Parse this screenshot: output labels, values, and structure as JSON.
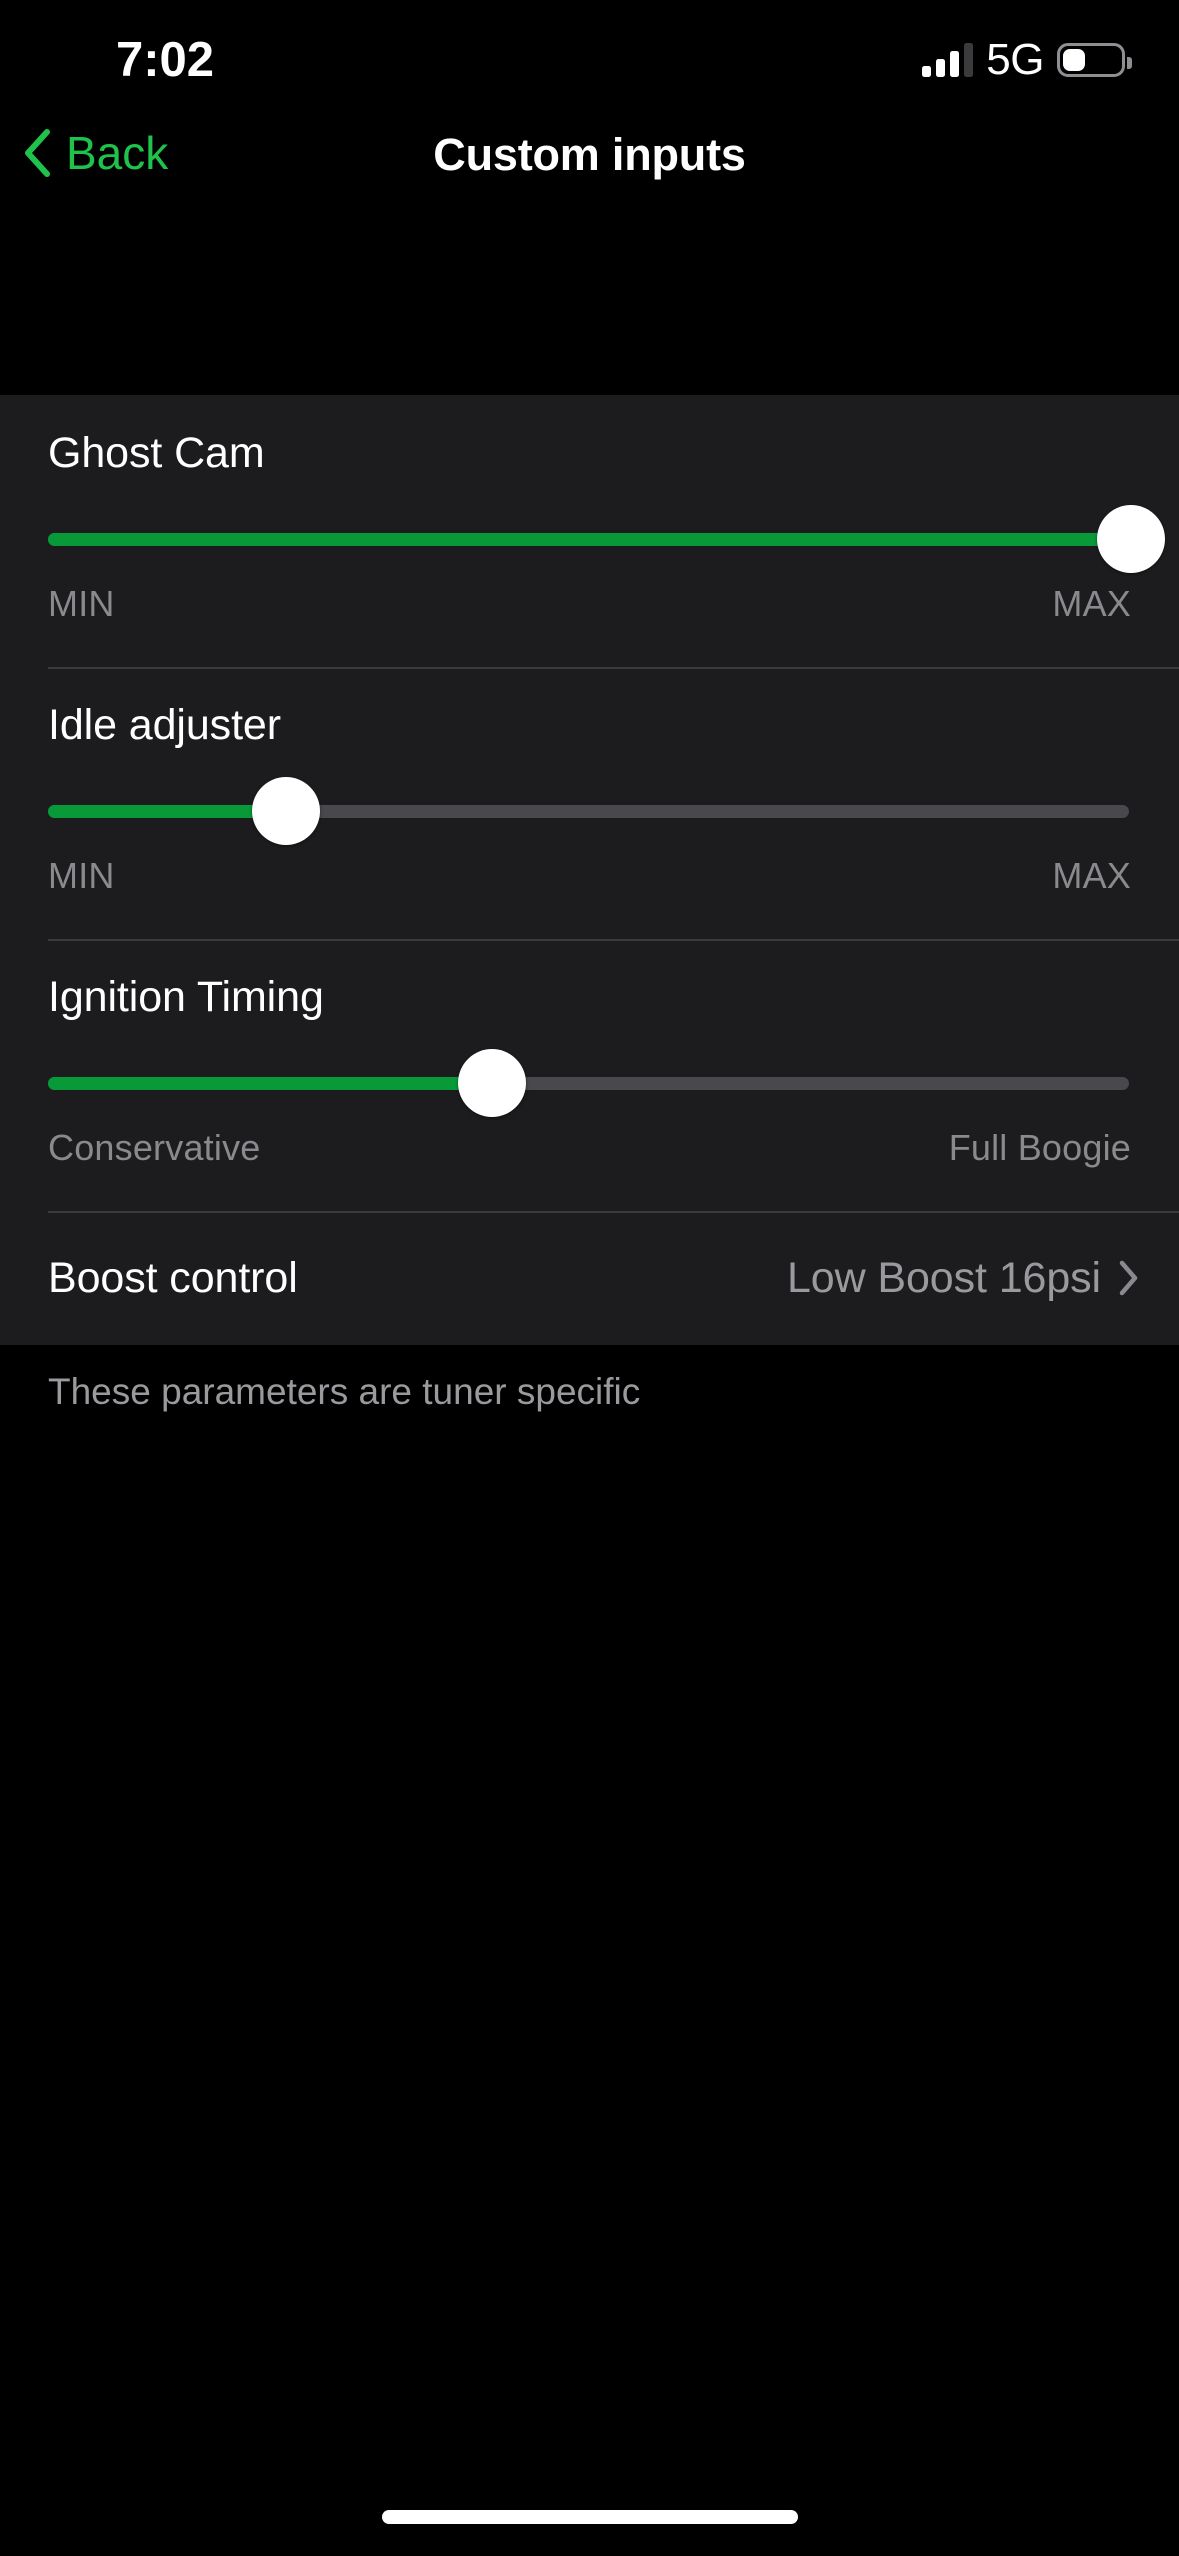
{
  "status_bar": {
    "time": "7:02",
    "network": "5G",
    "signal_bars_active": 3,
    "signal_bars_total": 4,
    "battery_percent": 35
  },
  "nav": {
    "back_label": "Back",
    "back_icon": "chevron-left-icon",
    "title": "Custom inputs",
    "accent_color": "#1FC24A"
  },
  "sliders": [
    {
      "label": "Ghost Cam",
      "value_percent": 100,
      "min_label": "MIN",
      "max_label": "MAX"
    },
    {
      "label": "Idle adjuster",
      "value_percent": 22,
      "min_label": "MIN",
      "max_label": "MAX"
    },
    {
      "label": "Ignition Timing",
      "value_percent": 41,
      "min_label": "Conservative",
      "max_label": "Full Boogie"
    }
  ],
  "disclosure": {
    "label": "Boost control",
    "value": "Low Boost 16psi",
    "icon": "chevron-right-icon"
  },
  "footer": {
    "note": "These parameters are tuner specific"
  },
  "colors": {
    "accent_green": "#089A38",
    "back_green": "#1FC24A",
    "card_background": "#1C1C1E",
    "page_background": "#000000",
    "track_inactive": "#48484D",
    "separator": "#3A3A3C",
    "secondary_text": "#8A8A8E"
  }
}
